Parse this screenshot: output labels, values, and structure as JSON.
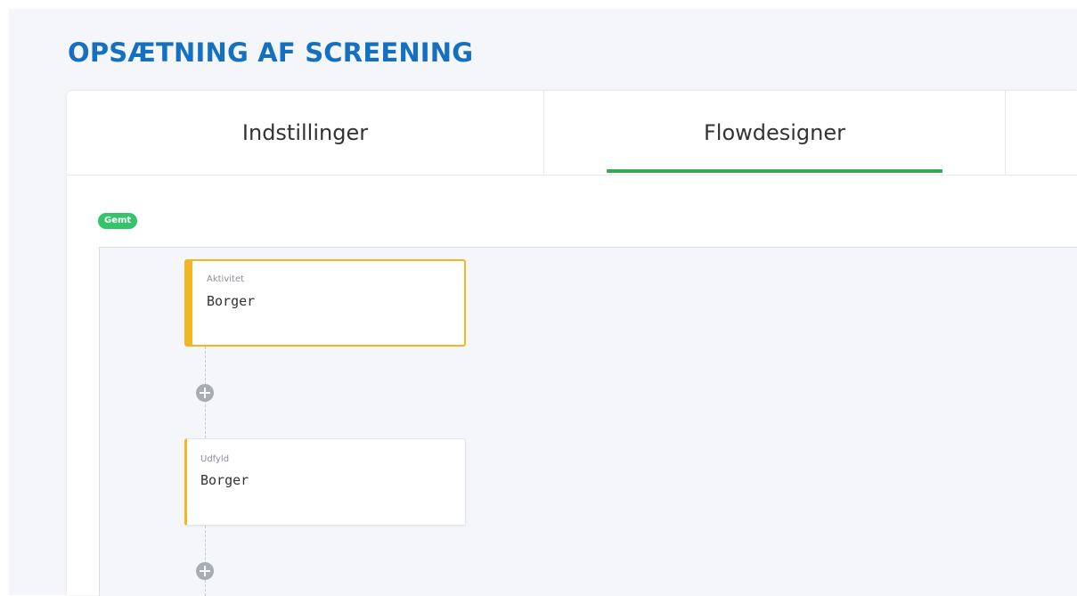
{
  "page": {
    "title": "OPSÆTNING AF SCREENING"
  },
  "tabs": [
    {
      "label": "Indstillinger",
      "active": false
    },
    {
      "label": "Flowdesigner",
      "active": true
    },
    {
      "label": "",
      "active": false
    }
  ],
  "status": {
    "badge": "Gemt",
    "color": "#35c46b"
  },
  "flow": {
    "nodes": [
      {
        "type": "Aktivitet",
        "name": "Borger",
        "selected": true
      },
      {
        "type": "Udfyld",
        "name": "Borger",
        "selected": false
      }
    ],
    "add_step_icon": "plus-circle-icon"
  },
  "colors": {
    "title": "#1670c2",
    "active_tab_underline": "#3aa755",
    "node_accent": "#f2b624",
    "add_icon": "#a8adb4"
  }
}
